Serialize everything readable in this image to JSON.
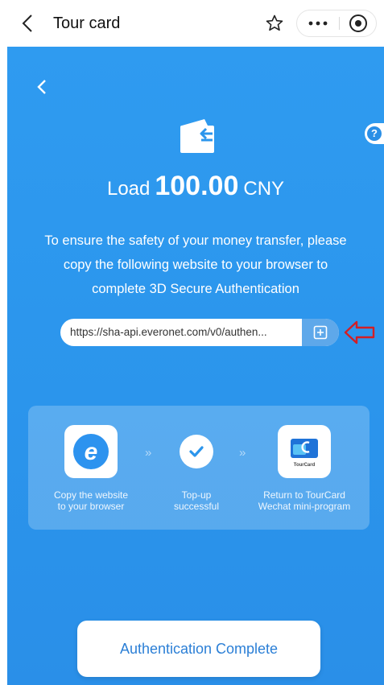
{
  "navbar": {
    "title": "Tour card"
  },
  "page": {
    "load_prefix": "Load",
    "load_amount": "100.00",
    "load_currency": "CNY",
    "notice_line1": "To ensure the safety of your money transfer, please",
    "notice_line2": "copy the following website to your browser to",
    "notice_line3": "complete 3D Secure Authentication",
    "url_value": "https://sha-api.everonet.com/v0/authen...",
    "help_label": "?"
  },
  "steps": [
    {
      "label_line1": "Copy the website",
      "label_line2": "to your browser",
      "icon": "browser-icon"
    },
    {
      "label_line1": "Top-up",
      "label_line2": "successful",
      "icon": "check-icon"
    },
    {
      "label_line1": "Return to TourCard",
      "label_line2": "Wechat mini-program",
      "icon": "tourcard-icon"
    }
  ],
  "tourcard_logo_text": "TourCard",
  "chevrons": "»",
  "auth_button_label": "Authentication Complete",
  "colors": {
    "page_blue": "#2b95ec",
    "button_text": "#2b7fd6",
    "arrow_red": "#d21f26"
  }
}
